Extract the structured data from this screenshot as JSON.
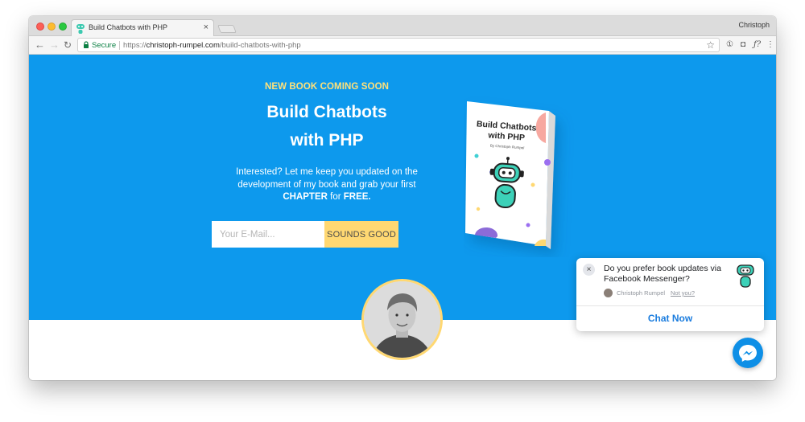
{
  "browser": {
    "tab_title": "Build Chatbots with PHP",
    "tab_close": "×",
    "profile_name": "Christoph",
    "secure_label": "Secure",
    "url_scheme": "https://",
    "url_host": "christoph-rumpel.com",
    "url_path": "/build-chatbots-with-php",
    "star_icon": "☆",
    "extensions": [
      "①",
      "◘",
      "ƒ?",
      "⋮"
    ],
    "nav": {
      "back": "←",
      "forward": "→",
      "reload": "↻"
    }
  },
  "hero": {
    "background": "#0d99ed",
    "eyebrow": "NEW BOOK COMING SOON",
    "headline_line1": "Build Chatbots",
    "headline_line2": "with PHP",
    "copy_part1": "Interested? Let me keep you updated on the development of my book and grab your first",
    "copy_strong1": "CHAPTER",
    "copy_part2": "for",
    "copy_strong2": "FREE.",
    "email_placeholder": "Your E-Mail...",
    "submit_label": "SOUNDS GOOD",
    "accent": "#ffd872"
  },
  "book": {
    "title_line1": "Build Chatbots",
    "title_line2": "with PHP",
    "author": "By Christoph Rumpel"
  },
  "messenger_popup": {
    "close": "×",
    "question": "Do you prefer book updates via Facebook Messenger?",
    "sender": "Christoph Rumpel",
    "not_you": "Not you?",
    "cta": "Chat Now"
  }
}
